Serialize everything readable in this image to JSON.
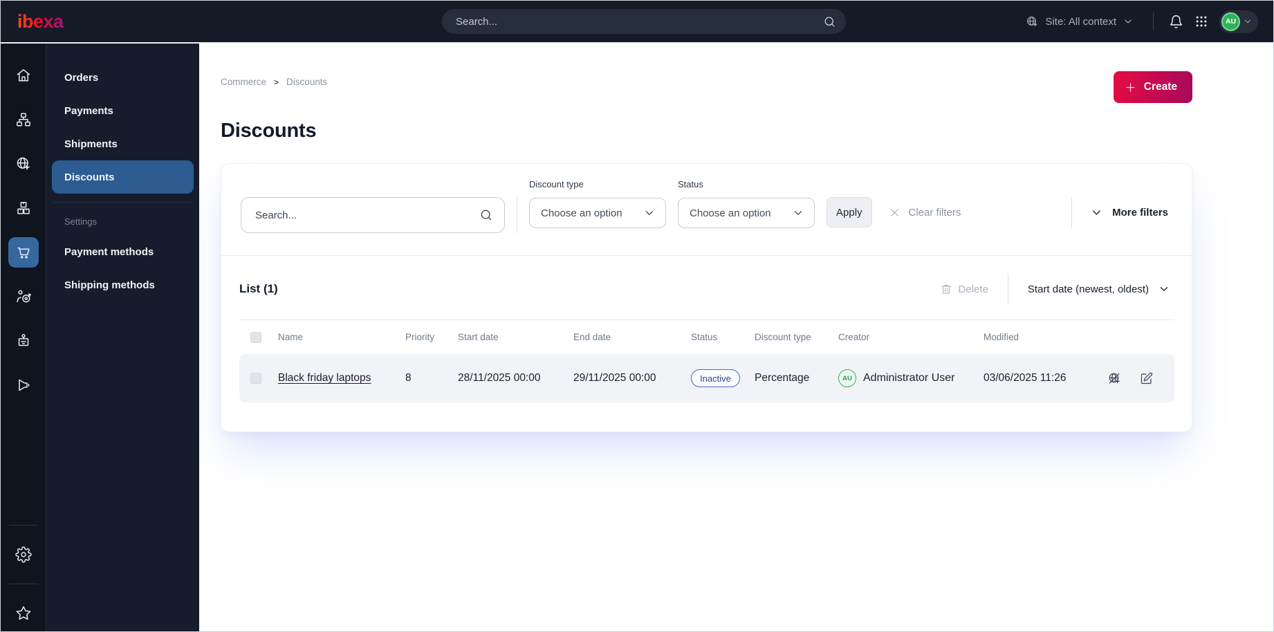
{
  "topbar": {
    "logo_text": "ibexa",
    "search_placeholder": "Search...",
    "site_context_label": "Site: All context",
    "avatar_initials": "AU"
  },
  "sidebar_rail": {
    "items": [
      {
        "icon": "home"
      },
      {
        "icon": "sitemap"
      },
      {
        "icon": "globe-cursor"
      },
      {
        "icon": "product-boxes"
      },
      {
        "icon": "commerce-cart",
        "active": true
      },
      {
        "icon": "customer-target"
      },
      {
        "icon": "job-badge"
      },
      {
        "icon": "megaphone"
      }
    ],
    "footer": [
      {
        "icon": "settings-gear"
      },
      {
        "icon": "favorites-star"
      }
    ]
  },
  "menu": {
    "items": [
      {
        "label": "Orders"
      },
      {
        "label": "Payments"
      },
      {
        "label": "Shipments"
      },
      {
        "label": "Discounts",
        "active": true
      }
    ],
    "section_label": "Settings",
    "settings_items": [
      {
        "label": "Payment methods"
      },
      {
        "label": "Shipping methods"
      }
    ]
  },
  "breadcrumb": {
    "parent": "Commerce",
    "separator": ">",
    "current": "Discounts"
  },
  "page": {
    "title": "Discounts",
    "create_button": "Create"
  },
  "filters": {
    "search_placeholder": "Search...",
    "discount_type_label": "Discount type",
    "discount_type_value": "Choose an option",
    "status_label": "Status",
    "status_value": "Choose an option",
    "apply_label": "Apply",
    "clear_label": "Clear filters",
    "more_label": "More filters"
  },
  "list": {
    "title": "List (1)",
    "delete_label": "Delete",
    "sort_label": "Start date (newest, oldest)",
    "columns": [
      "Name",
      "Priority",
      "Start date",
      "End date",
      "Status",
      "Discount type",
      "Creator",
      "Modified"
    ],
    "rows": [
      {
        "name": "Black friday laptops",
        "priority": "8",
        "start_date": "28/11/2025 00:00",
        "end_date": "29/11/2025 00:00",
        "status": "Inactive",
        "discount_type": "Percentage",
        "creator_initials": "AU",
        "creator_name": "Administrator User",
        "modified": "03/06/2025 11:26"
      }
    ]
  },
  "colors": {
    "topbar_bg": "#151a27",
    "rail_bg": "#10141e",
    "panel_bg": "#161c2b",
    "active_blue": "#2c5c92",
    "rail_active_blue": "#36689f",
    "brand_gradient_start": "#e60b42",
    "brand_gradient_end": "#a60a5c",
    "badge_border": "#4d68c4",
    "badge_text": "#32478f",
    "avatar_green": "#2eb05a",
    "row_bg": "#f2f3f7"
  }
}
